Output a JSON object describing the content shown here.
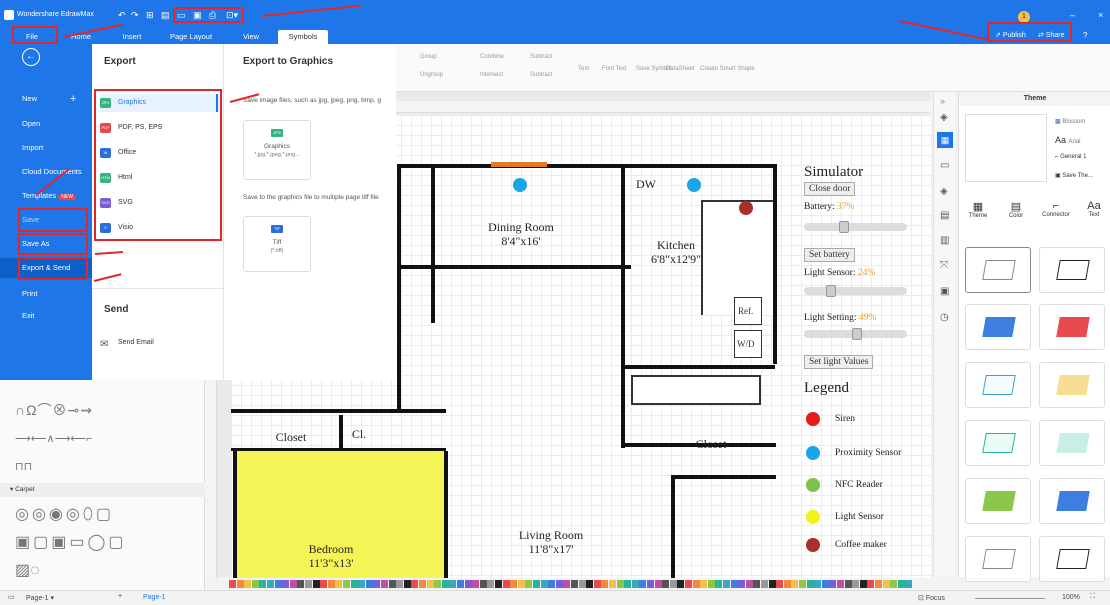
{
  "app": {
    "title": "Wondershare EdrawMax",
    "publish": "Publish",
    "share": "Share",
    "badge": "1"
  },
  "menu": {
    "tabs": [
      "File",
      "Home",
      "Insert",
      "Page Layout",
      "View",
      "Symbols"
    ]
  },
  "file_menu": {
    "items": [
      "New",
      "Open",
      "Import",
      "Cloud Documents",
      "Templates",
      "Save",
      "Save As",
      "Export & Send",
      "Print",
      "Exit"
    ],
    "new_badge": "NEW"
  },
  "export_panel": {
    "heading": "Export",
    "items": [
      {
        "icon": "JPG",
        "label": "Graphics",
        "color": "#36b37e"
      },
      {
        "icon": "PDF",
        "label": "PDF, PS, EPS",
        "color": "#e5484d"
      },
      {
        "icon": "W",
        "label": "Office",
        "color": "#2b6fd6"
      },
      {
        "icon": "HTM",
        "label": "Html",
        "color": "#36b37e"
      },
      {
        "icon": "SVG",
        "label": "SVG",
        "color": "#7a5cd6"
      },
      {
        "icon": "V",
        "label": "Visio",
        "color": "#2b6fd6"
      }
    ],
    "send_heading": "Send",
    "send_email": "Send Email"
  },
  "graphics_panel": {
    "heading": "Export to Graphics",
    "desc": "Save image files, such as jpg, jpeg, png, bmp, g",
    "card1_title": "Graphics",
    "card1_sub": "*.jpg,*.jpeg,*.png...",
    "desc2": "Save to the graphics file to multiple page tiff file",
    "card2_title": "Tiff",
    "card2_sub": "(*.tiff)"
  },
  "ribbon": {
    "items": [
      "Group",
      "Combine",
      "Subtract",
      "Text",
      "Font Text",
      "Save Symbol",
      "DataSheet",
      "Create Smart Shape",
      "Ungroup",
      "Intersect",
      "Subtract"
    ]
  },
  "floorplan": {
    "rooms": [
      {
        "name": "Dining Room",
        "dim": "8'4\"x16'"
      },
      {
        "name": "Kitchen",
        "dim": "6'8\"x12'9\""
      },
      {
        "name": "Living Room",
        "dim": "11'8\"x17'"
      },
      {
        "name": "Bedroom",
        "dim": "11'3\"x13'"
      }
    ],
    "labels": {
      "dw": "DW",
      "closet1": "Closet",
      "cl": "Cl.",
      "closet2": "Closet",
      "ref": "Ref.",
      "wd": "W/D"
    }
  },
  "simulator": {
    "title": "Simulator",
    "close_door": "Close door",
    "battery_label": "Battery:",
    "battery_value": "37%",
    "set_battery": "Set battery",
    "light_sensor_label": "Light Sensor:",
    "light_sensor_value": "24%",
    "light_setting_label": "Light Setting:",
    "light_setting_value": "49%",
    "set_light": "Set light Values",
    "battery_level": 0.37,
    "light_sensor_level": 0.24,
    "light_setting_level": 0.49
  },
  "legend": {
    "title": "Legend",
    "items": [
      {
        "label": "Siren",
        "color": "#e81b1b"
      },
      {
        "label": "Proximity Sensor",
        "color": "#1aa5e8"
      },
      {
        "label": "NFC Reader",
        "color": "#7cc24b"
      },
      {
        "label": "Light Sensor",
        "color": "#f2f218"
      },
      {
        "label": "Coffee maker",
        "color": "#a8302c"
      }
    ]
  },
  "theme": {
    "title": "Theme",
    "options": [
      "Blossom",
      "Arial",
      "General 1",
      "Save The..."
    ],
    "tabs": [
      "Theme",
      "Color",
      "Connector",
      "Text"
    ]
  },
  "library": {
    "section": "Carpet"
  },
  "status": {
    "page_selector": "Page-1",
    "page_tab": "Page-1",
    "focus": "Focus",
    "zoom": "100%"
  }
}
